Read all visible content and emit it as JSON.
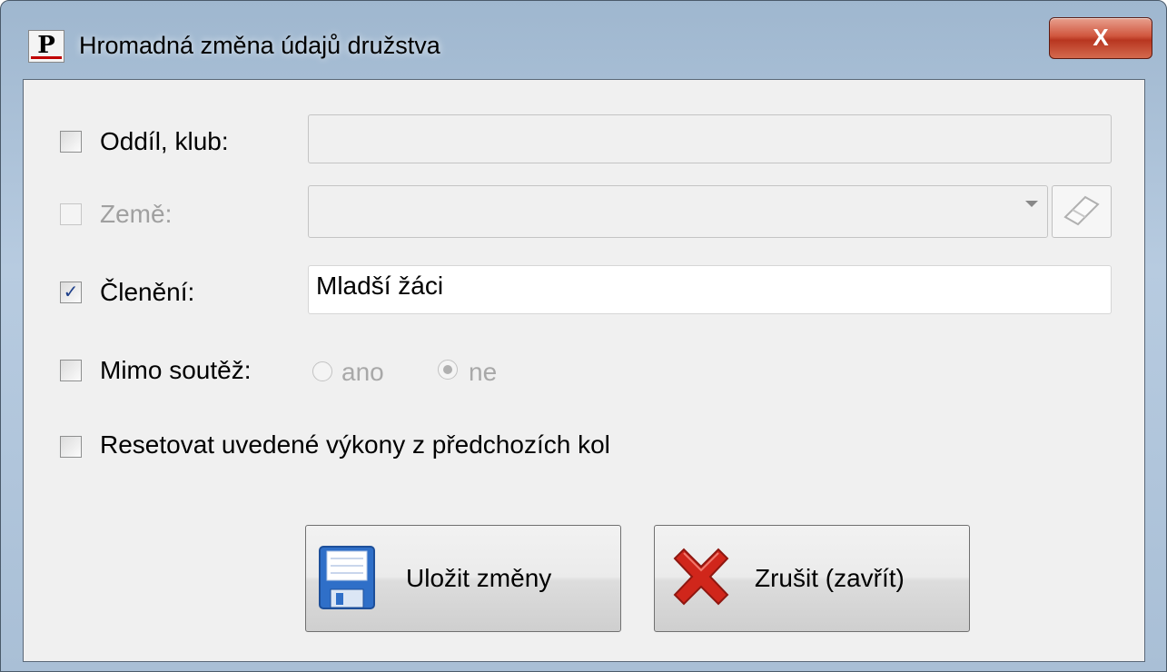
{
  "window": {
    "title": "Hromadná změna údajů družstva",
    "title_icon_letter": "P",
    "close_label": "X"
  },
  "form": {
    "club": {
      "label": "Oddíl, klub:",
      "checked": false,
      "enabled": true,
      "value": ""
    },
    "country": {
      "label": "Země:",
      "checked": false,
      "enabled": false,
      "value": ""
    },
    "division": {
      "label": "Členění:",
      "checked": true,
      "enabled": true,
      "value": "Mladší žáci"
    },
    "out_of_competition": {
      "label": "Mimo soutěž:",
      "checked": false,
      "options": [
        {
          "label": "ano",
          "selected": false
        },
        {
          "label": "ne",
          "selected": true
        }
      ]
    },
    "reset": {
      "label": "Resetovat uvedené výkony z předchozích kol",
      "checked": false
    }
  },
  "buttons": {
    "save": {
      "label": "Uložit změny",
      "icon": "floppy-disk-icon"
    },
    "cancel": {
      "label": "Zrušit (zavřít)",
      "icon": "red-x-icon"
    }
  },
  "icons": {
    "check_mark": "✓"
  },
  "colors": {
    "accent": "#1e3f8a",
    "close": "#c7452c",
    "cancel_x": "#d0261b",
    "floppy": "#2f6fc8"
  }
}
